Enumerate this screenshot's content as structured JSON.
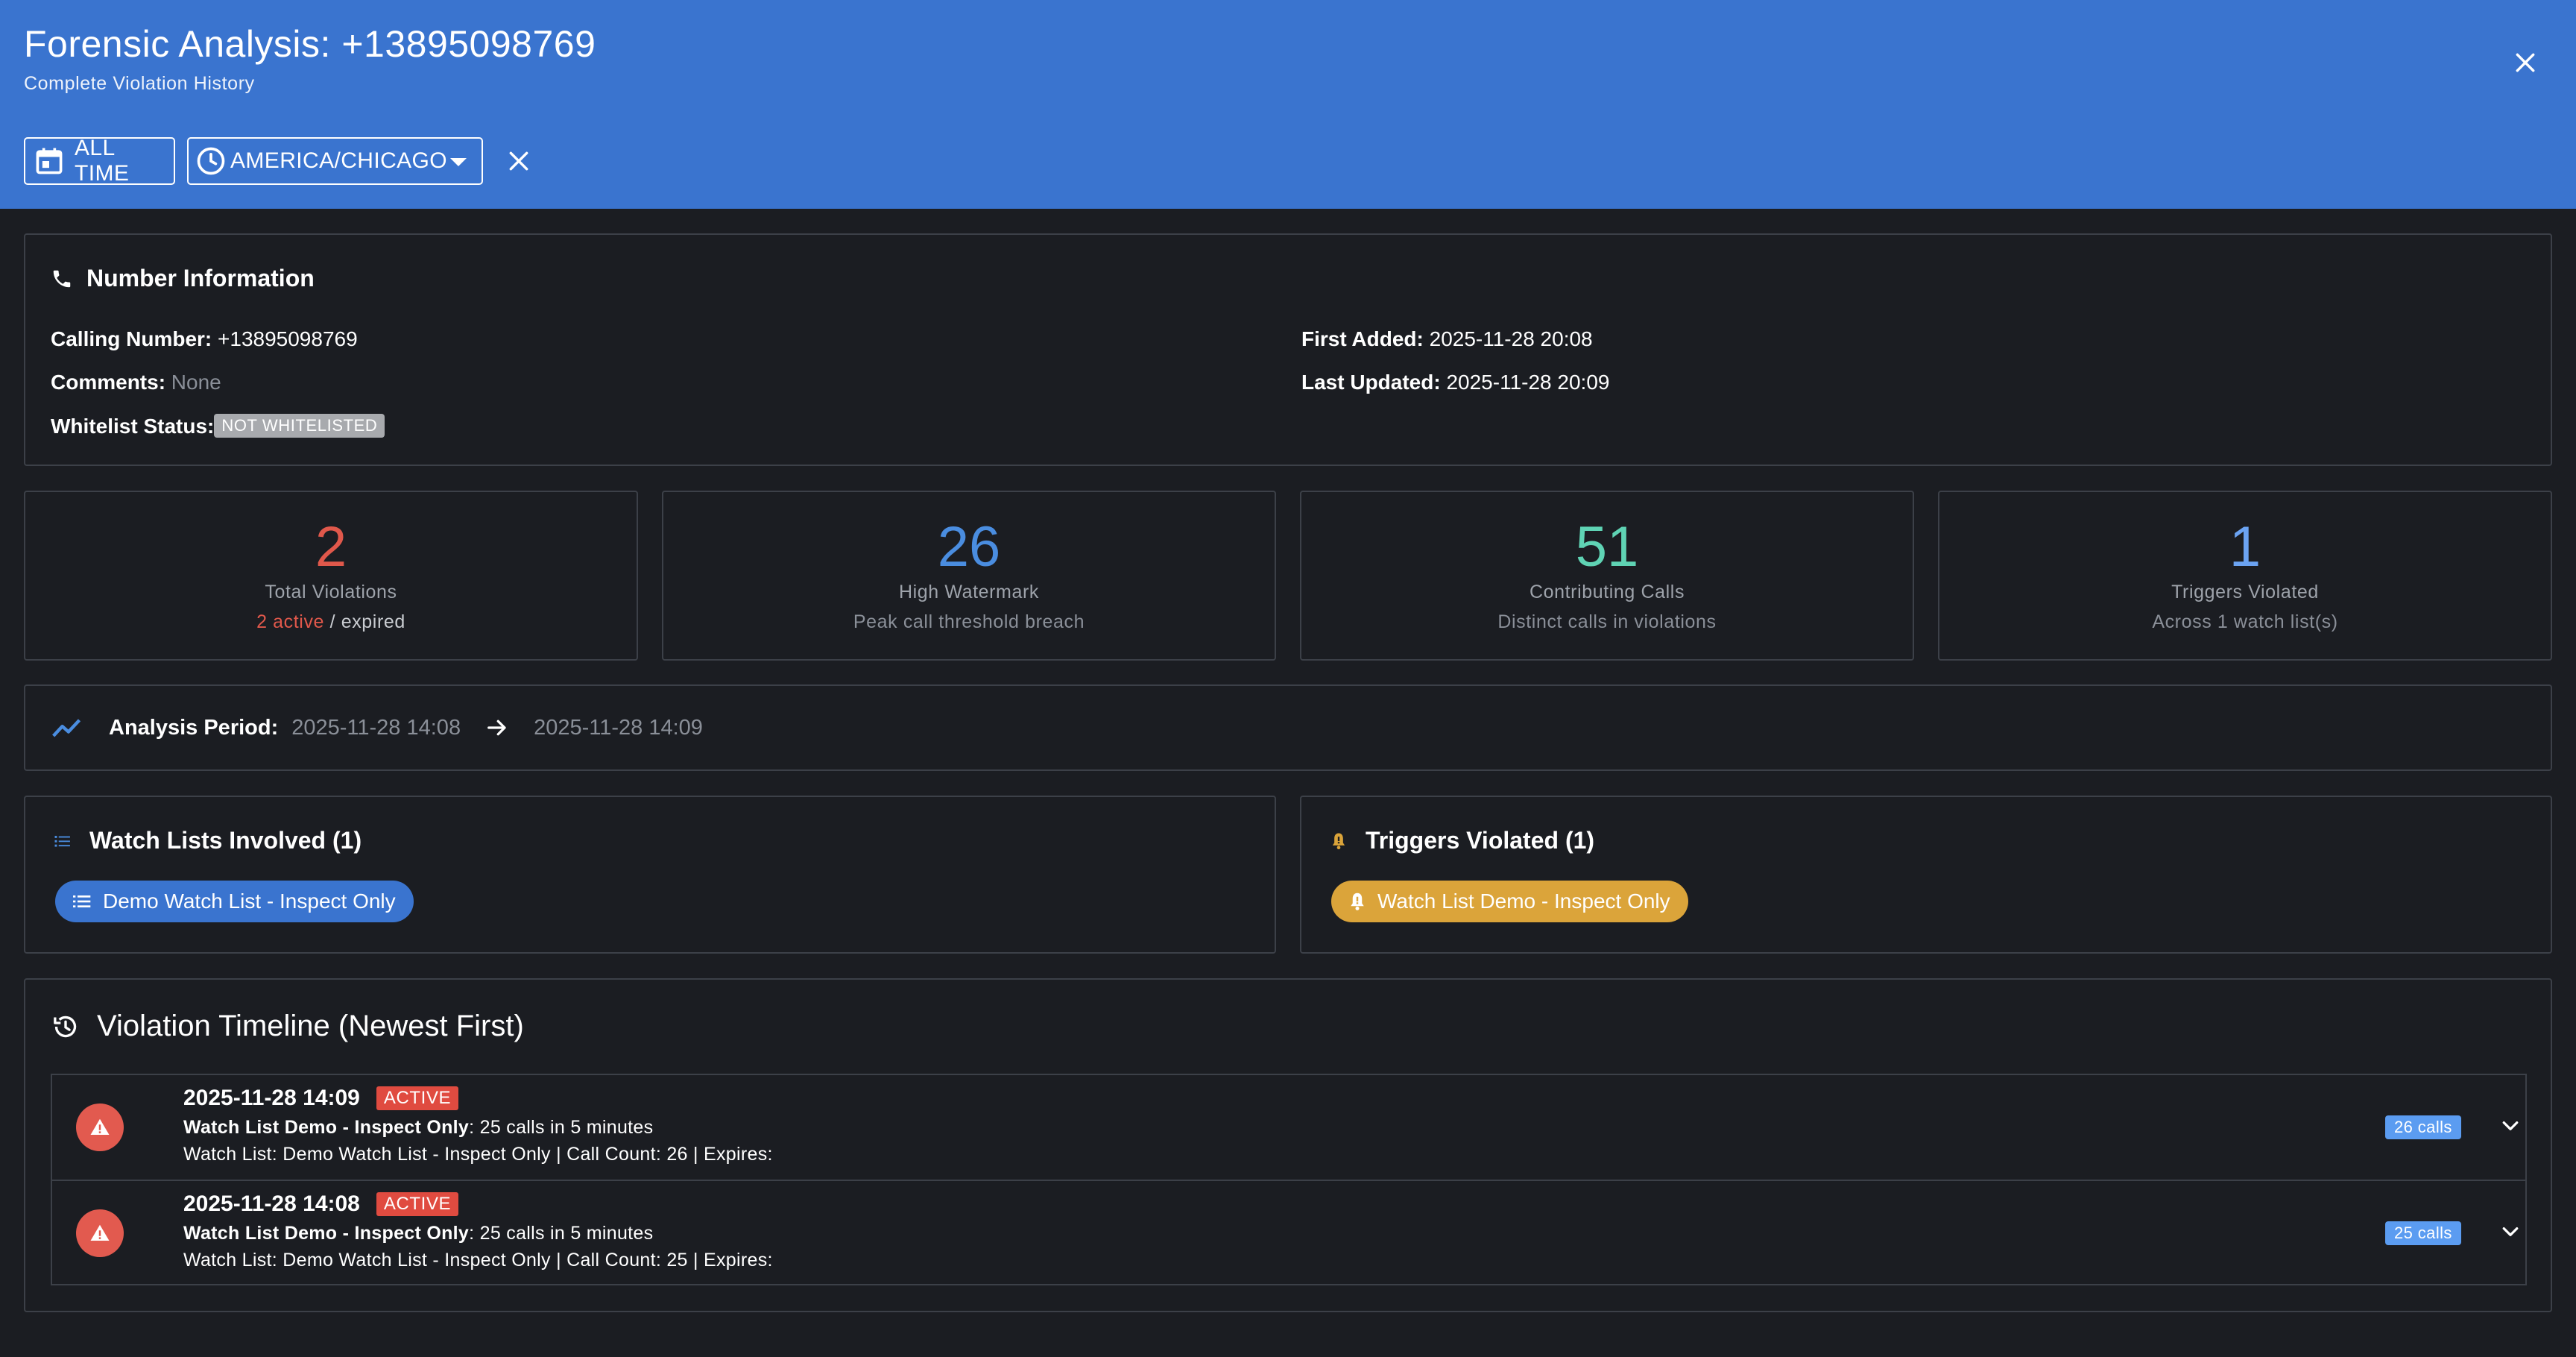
{
  "header": {
    "title": "Forensic Analysis: +13895098769",
    "subtitle": "Complete Violation History",
    "all_time_label": "ALL TIME",
    "timezone_label": "AMERICA/CHICAGO"
  },
  "number_info": {
    "title": "Number Information",
    "calling_number_label": "Calling Number:",
    "calling_number": "+13895098769",
    "comments_label": "Comments:",
    "comments": "None",
    "whitelist_label": "Whitelist Status:",
    "whitelist_status": "NOT WHITELISTED",
    "first_added_label": "First Added:",
    "first_added": "2025-11-28 20:08",
    "last_updated_label": "Last Updated:",
    "last_updated": "2025-11-28 20:09"
  },
  "stats": [
    {
      "value": "2",
      "label": "Total Violations",
      "sub_active": "2 active",
      "sub_sep": " / ",
      "sub_expired": "expired",
      "color": "#e0584b"
    },
    {
      "value": "26",
      "label": "High Watermark",
      "sub": "Peak call threshold breach",
      "color": "#4a8de0"
    },
    {
      "value": "51",
      "label": "Contributing Calls",
      "sub": "Distinct calls in violations",
      "color": "#5fd3b4"
    },
    {
      "value": "1",
      "label": "Triggers Violated",
      "sub": "Across 1 watch list(s)",
      "color": "#6ba3f2"
    }
  ],
  "period": {
    "label": "Analysis Period:",
    "start": "2025-11-28 14:08",
    "end": "2025-11-28 14:09"
  },
  "watch_lists": {
    "title": "Watch Lists Involved (1)",
    "items": [
      "Demo Watch List - Inspect Only"
    ]
  },
  "triggers": {
    "title": "Triggers Violated (1)",
    "items": [
      "Watch List Demo - Inspect Only"
    ]
  },
  "timeline": {
    "title": "Violation Timeline (Newest First)",
    "entries": [
      {
        "time": "2025-11-28 14:09",
        "status": "ACTIVE",
        "trigger": "Watch List Demo - Inspect Only",
        "rule": ": 25 calls in 5 minutes",
        "detail": "Watch List: Demo Watch List - Inspect Only | Call Count: 26 | Expires:",
        "calls": "26 calls"
      },
      {
        "time": "2025-11-28 14:08",
        "status": "ACTIVE",
        "trigger": "Watch List Demo - Inspect Only",
        "rule": ": 25 calls in 5 minutes",
        "detail": "Watch List: Demo Watch List - Inspect Only | Call Count: 25 | Expires:",
        "calls": "25 calls"
      }
    ]
  },
  "colors": {
    "header_bg": "#3a74cf",
    "body_bg": "#1b1d22",
    "active_red": "#e04b40",
    "calls_blue": "#5b9cf1",
    "trigger_gold": "#dba43a"
  },
  "icons": {
    "close": "close-icon",
    "calendar": "calendar-icon",
    "clock": "clock-icon",
    "phone": "phone-icon",
    "trend": "trending-up-icon",
    "arrow": "arrow-right-icon",
    "list": "list-icon",
    "bell": "bell-alert-icon",
    "history": "history-icon",
    "warning": "warning-icon",
    "chevron": "chevron-down-icon"
  }
}
